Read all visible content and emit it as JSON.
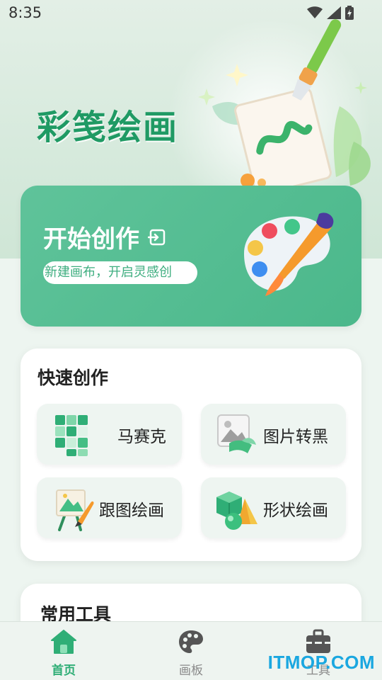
{
  "status_bar": {
    "time": "8:35"
  },
  "header": {
    "app_title": "彩笺绘画"
  },
  "start_card": {
    "title": "开始创作",
    "subtitle": "新建画布，开启灵感创"
  },
  "quick_create": {
    "title": "快速创作",
    "items": [
      {
        "label": "马赛克",
        "icon": "mosaic-cubes-icon"
      },
      {
        "label": "图片转黑",
        "icon": "image-convert-icon"
      },
      {
        "label": "跟图绘画",
        "icon": "easel-trace-icon"
      },
      {
        "label": "形状绘画",
        "icon": "shapes-3d-icon"
      }
    ]
  },
  "tools": {
    "title": "常用工具"
  },
  "bottom_nav": {
    "items": [
      {
        "label": "首页",
        "icon": "home-icon",
        "active": true
      },
      {
        "label": "画板",
        "icon": "palette-icon",
        "active": false
      },
      {
        "label": "工具",
        "icon": "toolbox-icon",
        "active": false
      }
    ]
  },
  "watermark": "ITMOP.COM",
  "colors": {
    "brand_green": "#1f9a64",
    "card_green": "#5fc39a",
    "nav_inactive": "#8a8a8a",
    "watermark_blue": "#1aa7e0"
  }
}
